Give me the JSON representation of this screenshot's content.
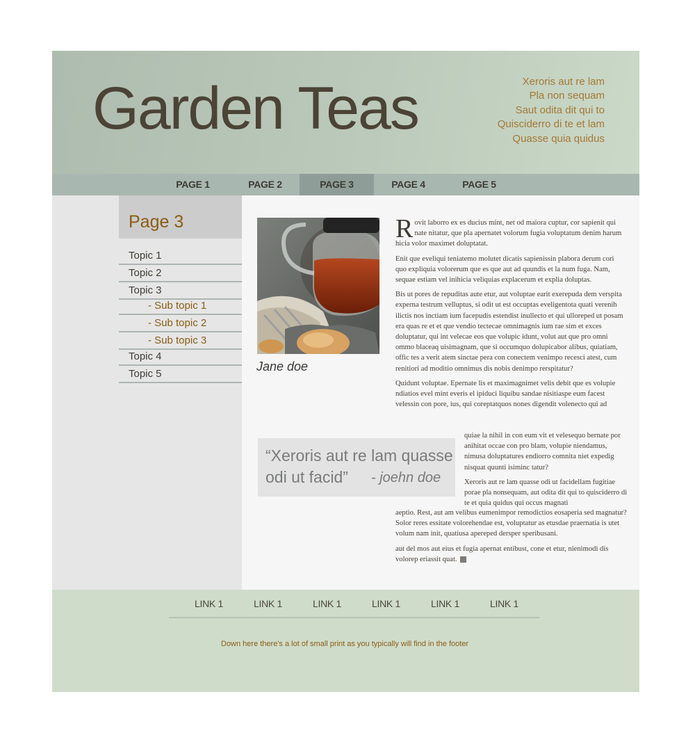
{
  "header": {
    "title": "Garden Teas",
    "tagline": [
      "Xeroris aut re lam",
      "Pla non sequam",
      "Saut odita dit qui to",
      "Quisciderro di te et lam",
      "Quasse quia quidus"
    ]
  },
  "nav": {
    "items": [
      "PAGE 1",
      "PAGE 2",
      "PAGE 3",
      "PAGE 4",
      "PAGE 5"
    ],
    "active": "PAGE 3"
  },
  "sidebar": {
    "title": "Page 3",
    "items": [
      "Topic 1",
      "Topic 2",
      "Topic 3",
      "- Sub topic 1",
      "- Sub topic 2",
      "- Sub topic 3",
      "Topic 4",
      "Topic 5"
    ]
  },
  "article": {
    "image_caption": "Jane doe",
    "dropcap": "R",
    "p1_rest": "ovit laborro ex es ducius mint, net od maiora cuptur, cor sapienit qui nate nitatur, que pla apernatet volorum fugia voluptatum denim harum hicia volor maximet doluptatat.",
    "p2": "Enit que eveliqui teniatemo molutet dicatis sapienissin plabora derum cori quo expliquia volorerum que es que aut ad quundis et la num fuga. Nam, sequae estiam vel inihicia veliquias explacerum et explia doluptas.",
    "p3": "Bis ut pores de repuditas aute etur, aut voluptae earit exerepuda dem verspita experna testrum velluptus, si odit ut est occuptas eveligentota quati verenih ilictis nos inctiam ium facepudis estendist inullecto et qui ulloreped ut posam era quas re et et que vendio tectecae omnimagnis ium rae sim et exces doluptatur, qui int velecae eos que volupic idunt, volut aut que pro omni ommo blaceaq uisimagnam, que si occumquo dolupicabor alibus, quiatiam, offic tes a verit atem sinctae pera con conectem venimpo recesci atest, cum renitiori ad moditio omnimus dis nobis denimpo rerspitatur?",
    "p4_top": "Quidunt voluptae. Epernate lis et maximagnimet velis debit que es volupie ndiatios evel mint everis el ipiduci liquibu sandae nisitiaspe eum facest velessin con pore, ius, qui coreptatquos nones digendit volenecto qui ad",
    "p4_wrap": "quiae la nihil in con eum vit et velesequo bernate por anihitat occae con pro blam, volupie niendamus, nimusa doluptatures endiorro comnita niet expedig nisquat quunti isiminc tatur?",
    "p5_wrap": "Xeroris aut re lam quasse odi ut facidellam fugitiae porae pla nonsequam, aut odita dit qui to quisciderro di te et quia quidus qui occus magnati",
    "p5_rest": "aeptio. Rest, aut am velibus eumenimpor remodictios eosaperia sed magnatur? Solor reres essitate volorehendae est, voluptatur as etusdae praernatia is utet volum nam init, quatiusa apereped dersper speribusani.",
    "p6": "aut del mos aut eius et fugia apernat entibust, cone et etur, nienimodi dis volorep eriassit quat.",
    "quote_text": "“Xeroris aut re lam quasse odi ut facid”",
    "quote_author": "- joehn doe"
  },
  "footer": {
    "links": [
      "LINK 1",
      "LINK 1",
      "LINK 1",
      "LINK 1",
      "LINK 1",
      "LINK 1"
    ],
    "small_print": "Down here there's a lot of small print as you typically will find in the footer"
  },
  "colors": {
    "title": "#4b4336",
    "accent": "#a47a35",
    "nav_bg": "#a8b7b0",
    "nav_active_bg": "#8e9d97",
    "footer_bg": "#cfdcca"
  },
  "icons": {
    "image": "teapot-photo"
  }
}
